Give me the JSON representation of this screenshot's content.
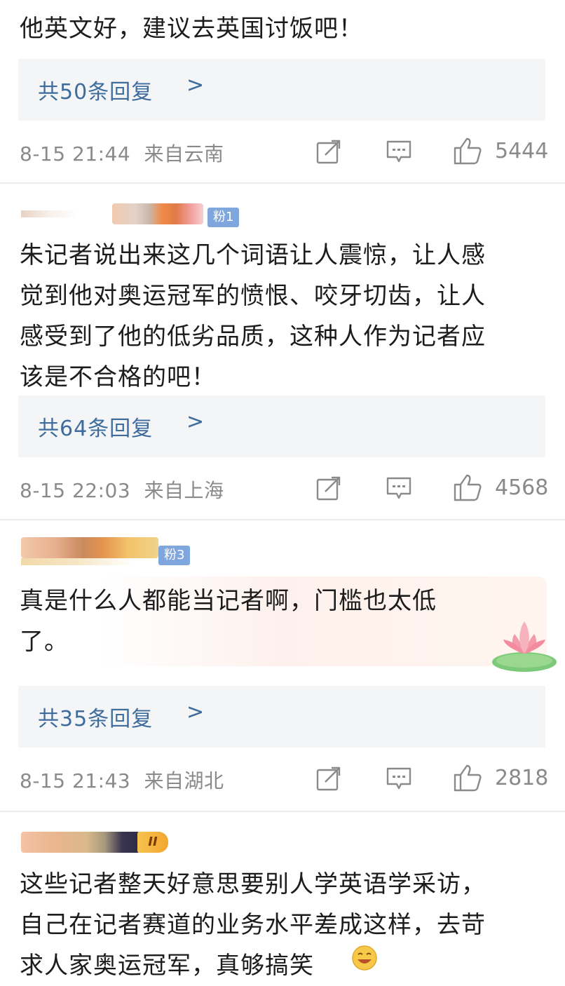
{
  "comments": [
    {
      "text": "他英文好，建议去英国讨饭吧！",
      "replies": "共50条回复",
      "time": "8-15 21:44",
      "location": "来自云南",
      "likes": "5444"
    },
    {
      "badge": "粉1",
      "text": "朱记者说出来这几个词语让人震惊，让人感\n觉到他对奥运冠军的愤恨、咬牙切齿，让人\n感受到了他的低劣品质，这种人作为记者应\n该是不合格的吧！",
      "replies": "共64条回复",
      "time": "8-15 22:03",
      "location": "来自上海",
      "likes": "4568"
    },
    {
      "badge": "粉3",
      "text": "真是什么人都能当记者啊，门槛也太低\n了。",
      "replies": "共35条回复",
      "time": "8-15 21:43",
      "location": "来自湖北",
      "likes": "2818"
    },
    {
      "badge": "II",
      "text": "这些记者整天好意思要别人学英语学采访，\n自己在记者赛道的业务水平差成这样，去苛\n求人家奥运冠军，真够搞笑"
    }
  ],
  "chevron": ">",
  "icons": {
    "share": "share-icon",
    "comment": "comment-icon",
    "like": "like-icon",
    "emoji": "laugh-emoji-icon",
    "decor": "lotus-icon"
  },
  "colors": {
    "link": "#3e6c9c",
    "meta": "#8a8a8a",
    "reply_bg": "#f4f5f7",
    "badge": "#7fa6dd"
  }
}
